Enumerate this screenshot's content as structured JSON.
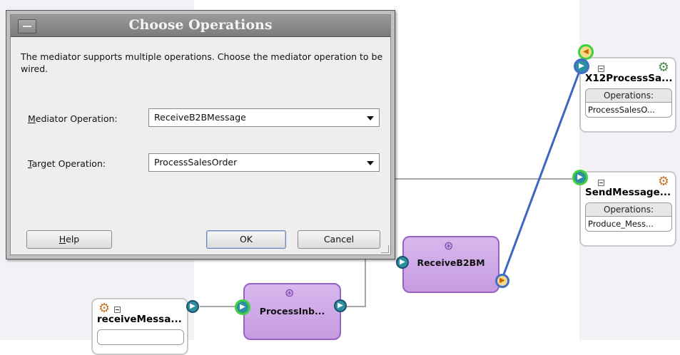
{
  "dialog": {
    "title": "Choose Operations",
    "description": "The mediator supports multiple operations.  Choose the mediator operation to be wired.",
    "mediator_operation": {
      "label_prefix": "",
      "label_mnemonic": "M",
      "label_rest": "ediator Operation:",
      "value": "ReceiveB2BMessage"
    },
    "target_operation": {
      "label_mnemonic": "T",
      "label_rest": "arget Operation:",
      "value": "ProcessSalesOrder"
    },
    "buttons": {
      "help_mnemonic": "H",
      "help_rest": "elp",
      "ok": "OK",
      "cancel": "Cancel"
    }
  },
  "services": {
    "x12": {
      "name": "X12ProcessSa...",
      "ops_header": "Operations:",
      "ops_value": "ProcessSalesO..."
    },
    "send": {
      "name": "SendMessage...",
      "ops_header": "Operations:",
      "ops_value": "Produce_Mess..."
    },
    "receive": {
      "name": "receiveMessa..."
    }
  },
  "mediators": {
    "receive_b2b": {
      "name": "ReceiveB2BM"
    },
    "process_inb": {
      "name": "ProcessInb..."
    }
  },
  "icons": {
    "gear": "gear-icon",
    "mediator": "mediator-icon",
    "collapse": "collapse-icon"
  },
  "colors": {
    "wire": "#3c66c4",
    "wire_gray": "#9a9a9a",
    "mediator_fill": "#c69be2",
    "selected_ring": "#3ed13e"
  }
}
